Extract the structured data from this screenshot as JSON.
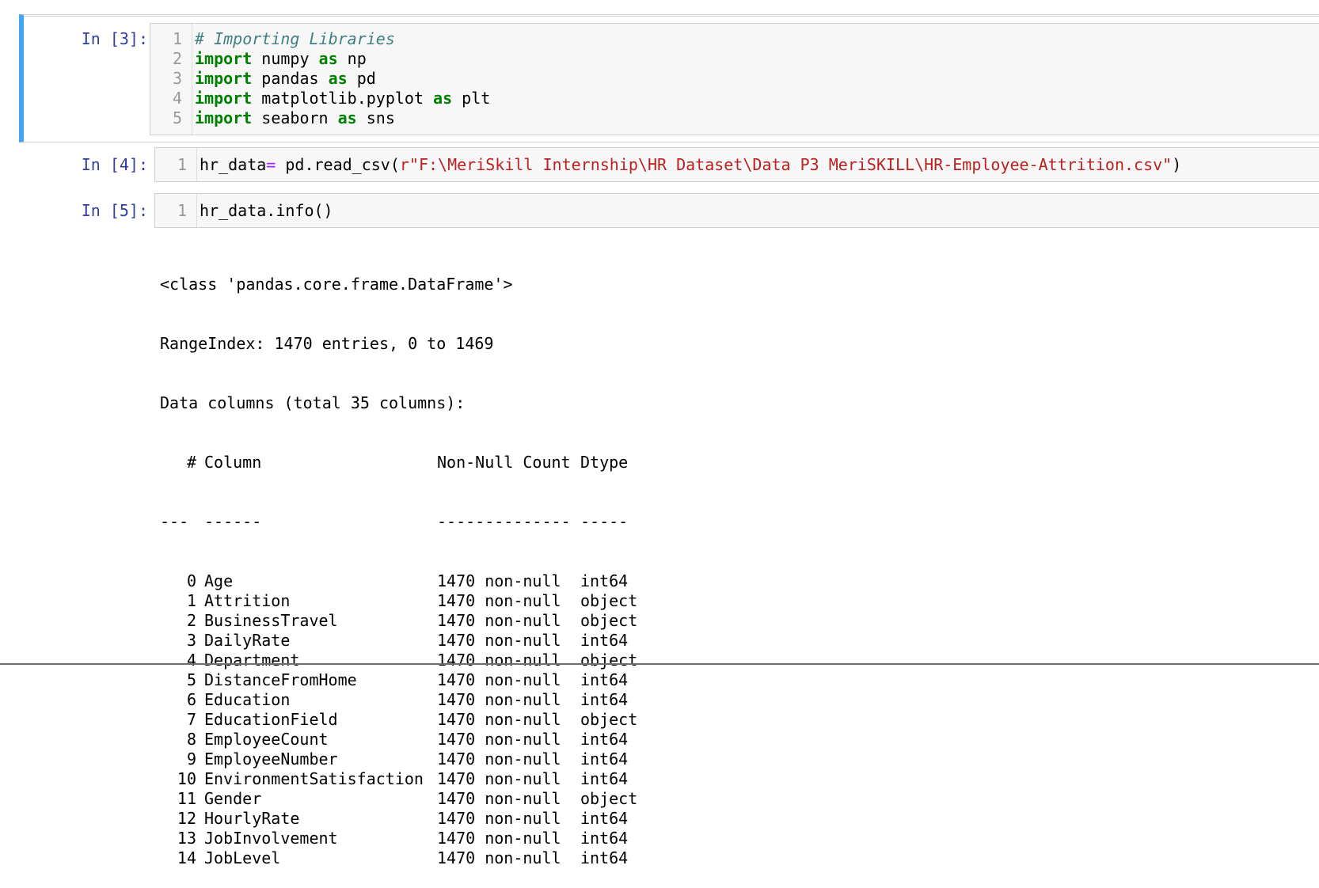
{
  "cells": [
    {
      "prompt": "In [3]:",
      "lines": [
        {
          "n": "1",
          "tokens": [
            {
              "t": "# Importing Libraries",
              "c": "cm"
            }
          ]
        },
        {
          "n": "2",
          "tokens": [
            {
              "t": "import",
              "c": "kw"
            },
            {
              "t": " numpy ",
              "c": "nm"
            },
            {
              "t": "as",
              "c": "kw"
            },
            {
              "t": " np",
              "c": "nm"
            }
          ]
        },
        {
          "n": "3",
          "tokens": [
            {
              "t": "import",
              "c": "kw"
            },
            {
              "t": " pandas ",
              "c": "nm"
            },
            {
              "t": "as",
              "c": "kw"
            },
            {
              "t": " pd",
              "c": "nm"
            }
          ]
        },
        {
          "n": "4",
          "tokens": [
            {
              "t": "import",
              "c": "kw"
            },
            {
              "t": " matplotlib.pyplot ",
              "c": "nm"
            },
            {
              "t": "as",
              "c": "kw"
            },
            {
              "t": " plt",
              "c": "nm"
            }
          ]
        },
        {
          "n": "5",
          "tokens": [
            {
              "t": "import",
              "c": "kw"
            },
            {
              "t": " seaborn ",
              "c": "nm"
            },
            {
              "t": "as",
              "c": "kw"
            },
            {
              "t": " sns",
              "c": "nm"
            }
          ]
        }
      ]
    },
    {
      "prompt": "In [4]:",
      "lines": [
        {
          "n": "1",
          "tokens": [
            {
              "t": "hr_data",
              "c": "nm"
            },
            {
              "t": "=",
              "c": "op"
            },
            {
              "t": " pd.read_csv(",
              "c": "nm"
            },
            {
              "t": "r\"F:\\MeriSkill Internship\\HR Dataset\\Data P3 MeriSKILL\\HR-Employee-Attrition.csv\"",
              "c": "st"
            },
            {
              "t": ")",
              "c": "nm"
            }
          ]
        }
      ]
    },
    {
      "prompt": "In [5]:",
      "lines": [
        {
          "n": "1",
          "tokens": [
            {
              "t": "hr_data.info()",
              "c": "nm"
            }
          ]
        }
      ]
    }
  ],
  "output": {
    "header_lines": [
      "<class 'pandas.core.frame.DataFrame'>",
      "RangeIndex: 1470 entries, 0 to 1469",
      "Data columns (total 35 columns):"
    ],
    "table_header": {
      "idx": "#",
      "col": "Column",
      "nn": "Non-Null Count",
      "dt": "Dtype"
    },
    "table_sep": {
      "idx": "---",
      "col": "------",
      "nn": "--------------",
      "dt": "-----"
    },
    "rows": [
      {
        "idx": "0",
        "col": "Age",
        "nn": "1470 non-null",
        "dt": "int64"
      },
      {
        "idx": "1",
        "col": "Attrition",
        "nn": "1470 non-null",
        "dt": "object"
      },
      {
        "idx": "2",
        "col": "BusinessTravel",
        "nn": "1470 non-null",
        "dt": "object"
      },
      {
        "idx": "3",
        "col": "DailyRate",
        "nn": "1470 non-null",
        "dt": "int64"
      },
      {
        "idx": "4",
        "col": "Department",
        "nn": "1470 non-null",
        "dt": "object"
      },
      {
        "idx": "5",
        "col": "DistanceFromHome",
        "nn": "1470 non-null",
        "dt": "int64"
      },
      {
        "idx": "6",
        "col": "Education",
        "nn": "1470 non-null",
        "dt": "int64"
      },
      {
        "idx": "7",
        "col": "EducationField",
        "nn": "1470 non-null",
        "dt": "object"
      },
      {
        "idx": "8",
        "col": "EmployeeCount",
        "nn": "1470 non-null",
        "dt": "int64"
      },
      {
        "idx": "9",
        "col": "EmployeeNumber",
        "nn": "1470 non-null",
        "dt": "int64"
      },
      {
        "idx": "10",
        "col": "EnvironmentSatisfaction",
        "nn": "1470 non-null",
        "dt": "int64"
      },
      {
        "idx": "11",
        "col": "Gender",
        "nn": "1470 non-null",
        "dt": "object"
      },
      {
        "idx": "12",
        "col": "HourlyRate",
        "nn": "1470 non-null",
        "dt": "int64"
      },
      {
        "idx": "13",
        "col": "JobInvolvement",
        "nn": "1470 non-null",
        "dt": "int64"
      },
      {
        "idx": "14",
        "col": "JobLevel",
        "nn": "1470 non-null",
        "dt": "int64"
      }
    ]
  },
  "colors": {
    "selected_cell_bar": "#42a5f5",
    "prompt": "#303f9f",
    "keyword": "#008000",
    "string": "#ba2121",
    "comment": "#408080",
    "operator": "#aa22ff"
  }
}
